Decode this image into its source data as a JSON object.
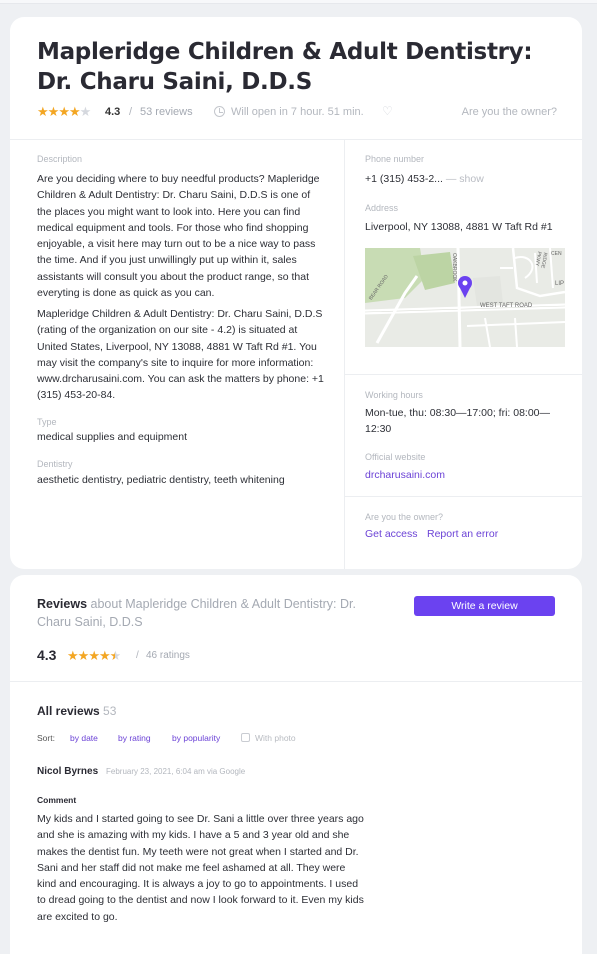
{
  "business": {
    "title": "Mapleridge Children & Adult Dentistry: Dr. Charu Saini, D.D.S",
    "rating": "4.3",
    "rating_value": 4.3,
    "slash": "/",
    "reviews_count": "53 reviews",
    "open_status": "Will open in 7 hour. 51 min.",
    "owner_question": "Are you the owner?"
  },
  "details": {
    "description_label": "Description",
    "description_p1": "Are you deciding where to buy needful products? Mapleridge Children & Adult Dentistry: Dr. Charu Saini, D.D.S is one of the places you might want to look into. Here you can find medical equipment and tools. For those who find shopping enjoyable, a visit here may turn out to be a nice way to pass the time. And if you just unwillingly put up within it, sales assistants will consult you about the product range, so that everyting is done as quick as you can.",
    "description_p2": "Mapleridge Children & Adult Dentistry: Dr. Charu Saini, D.D.S (rating of the organization on our site - 4.2) is situated at United States, Liverpool, NY 13088, 4881 W Taft Rd #1. You may visit the company's site to inquire for more information: www.drcharusaini.com. You can ask the matters by phone: +1 (315) 453-20-84.",
    "type_label": "Type",
    "type_value": "medical supplies and equipment",
    "category_label": "Dentistry",
    "category_value": "aesthetic dentistry, pediatric dentistry, teeth whitening"
  },
  "contact": {
    "phone_label": "Phone number",
    "phone_value": "+1 (315) 453-2...",
    "phone_show": " — show",
    "address_label": "Address",
    "address_value": "Liverpool, NY 13088, 4881 W Taft Rd #1",
    "hours_label": "Working hours",
    "hours_value": "Mon-tue, thu: 08:30—17:00; fri: 08:00—12:30",
    "website_label": "Official website",
    "website_value": "drcharusaini.com",
    "owner_label": "Are you the owner?",
    "get_access": "Get access",
    "report_error": "Report an error"
  },
  "map": {
    "road_labels": [
      "WEST TAFT ROAD",
      "BEAR ROAD",
      "OAKBROOK",
      "LIP",
      "RIDGE PKWY",
      "CEN"
    ],
    "colors": {
      "background": "#e9ebe6",
      "park": "#c8dcb4",
      "road": "#ffffff",
      "pin": "#6b42f0"
    }
  },
  "reviews": {
    "heading": "Reviews",
    "heading_about": "about Mapleridge Children & Adult Dentistry: Dr. Charu Saini, D.D.S",
    "write_button": "Write a review",
    "score": "4.3",
    "score_value": 4.3,
    "slash": "/",
    "ratings_count": "46 ratings",
    "all_reviews_label": "All reviews",
    "all_reviews_count": "53",
    "sort_label": "Sort:",
    "sort_options": [
      "by date",
      "by rating",
      "by popularity"
    ],
    "photo_filter": "With photo",
    "items": [
      {
        "author": "Nicol Byrnes",
        "date": "February 23, 2021, 6:04 am via Google",
        "comment_label": "Comment",
        "comment": "My kids and I started going to see Dr. Sani a little over three years ago and she is amazing with my kids. I have a 5 and 3 year old and she makes the dentist fun. My teeth were not great when I started and Dr. Sani and her staff did not make me feel ashamed at all. They were kind and encouraging. It is always a joy to go to appointments. I used to dread going to the dentist and now I look forward to it. Even my kids are excited to go."
      }
    ]
  },
  "colors": {
    "accent": "#6b42f0",
    "link": "#6b42d6",
    "star": "#f3a623",
    "star_empty": "#d5d8de"
  }
}
